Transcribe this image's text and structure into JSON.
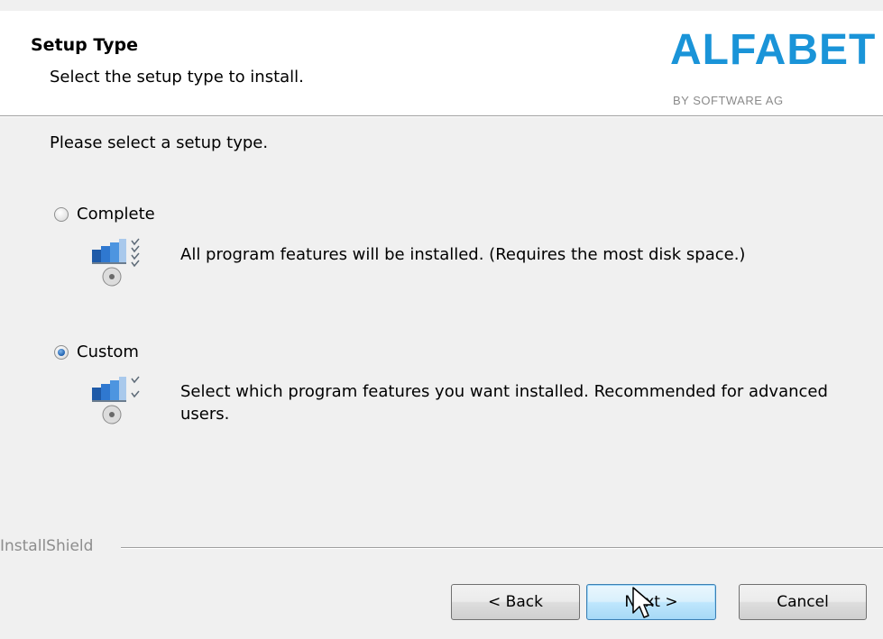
{
  "header": {
    "title": "Setup Type",
    "subtitle": "Select the setup type to install.",
    "logo_text": "ALFABET",
    "logo_subtext": "BY SOFTWARE AG"
  },
  "content": {
    "prompt": "Please select a setup type.",
    "options": [
      {
        "label": "Complete",
        "description": "All program features will be installed. (Requires the most disk space.)",
        "selected": false,
        "icon": "complete-setup-icon"
      },
      {
        "label": "Custom",
        "description": "Select which program features you want installed. Recommended for advanced users.",
        "selected": true,
        "icon": "custom-setup-icon"
      }
    ]
  },
  "footer": {
    "brand": "InstallShield",
    "back_label": "< Back",
    "next_label": "Next >",
    "cancel_label": "Cancel"
  },
  "colors": {
    "logo_blue": "#1a94d8",
    "dialog_bg": "#f0f0f0",
    "default_button": "#bee6fd"
  }
}
